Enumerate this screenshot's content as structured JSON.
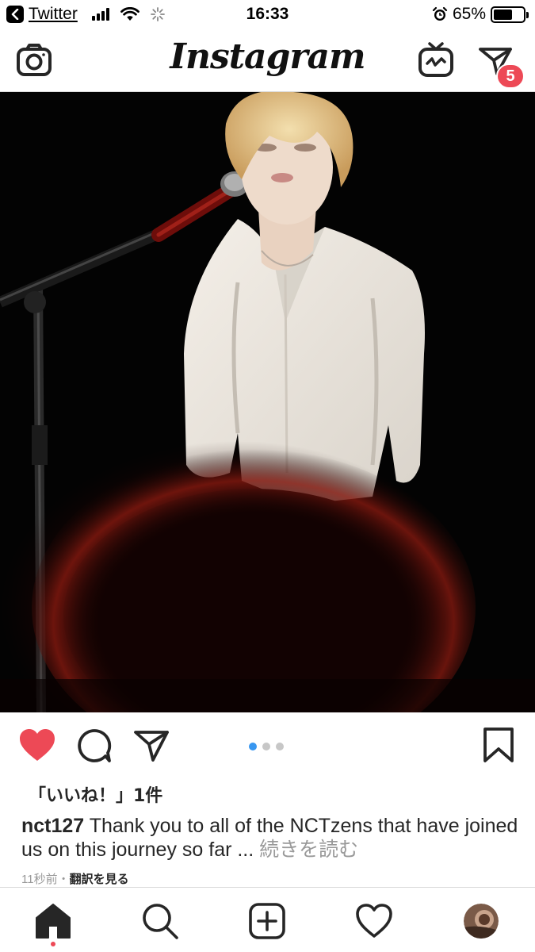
{
  "status_bar": {
    "back_app": "Twitter",
    "time": "16:33",
    "battery": "65%",
    "battery_level": 0.65
  },
  "header": {
    "logo": "Instagram",
    "direct_badge": "5"
  },
  "post": {
    "carousel": {
      "count": 3,
      "active_index": 0
    },
    "likes": "「いいね！」1件",
    "username": "nct127",
    "caption_text": "Thank you to all of the NCTzens that have joined us on this journey so far ...",
    "more_label": "続きを読む",
    "timestamp": "11秒前",
    "separator": "・",
    "translate_label": "翻訳を見る"
  },
  "colors": {
    "like_red": "#ed4956",
    "badge_red": "#ed4956",
    "dot_active": "#3897f0",
    "divider": "#dbdbdb",
    "muted_text": "#999999"
  },
  "icons": {
    "header": [
      "camera-icon",
      "igtv-icon",
      "direct-icon"
    ],
    "actions": [
      "heart-filled-icon",
      "comment-icon",
      "share-icon",
      "bookmark-icon"
    ],
    "nav": [
      "home-icon",
      "search-icon",
      "add-post-icon",
      "heart-outline-icon",
      "profile-avatar"
    ]
  }
}
